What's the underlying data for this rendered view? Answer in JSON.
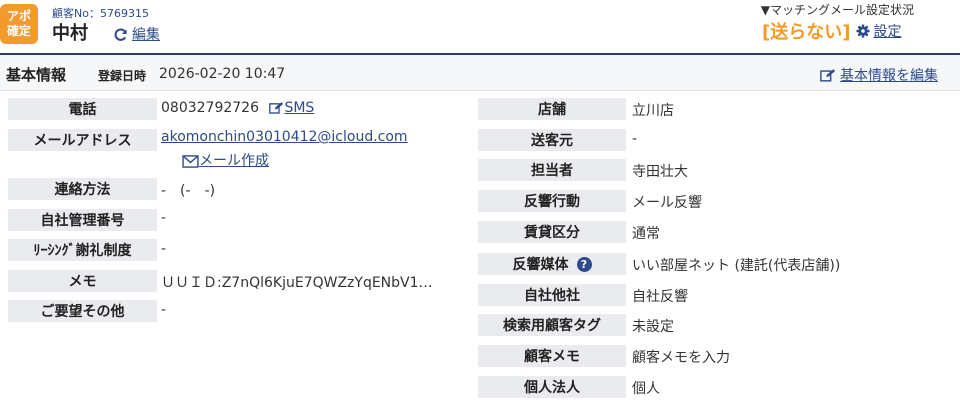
{
  "header": {
    "badge_line1": "アポ",
    "badge_line2": "確定",
    "customer_no": "顧客No：5769315",
    "customer_name": "中村",
    "edit_label": "編集",
    "matching_label": "▼マッチングメール設定状況",
    "no_send_label": "[送らない]",
    "settings_label": "設定",
    "accent_color": "#f39a2c",
    "link_color": "#2c4a8c"
  },
  "section": {
    "title": "基本情報",
    "registered_label": "登録日時",
    "registered_value": "2026-02-20 10:47",
    "edit_basic_label": "基本情報を編集"
  },
  "left_fields": {
    "phone": {
      "label": "電話",
      "value": "08032792726",
      "sms_label": "SMS"
    },
    "email": {
      "label": "メールアドレス",
      "value": "akomonchin03010412@icloud.com",
      "compose_label": "メール作成"
    },
    "contact_method": {
      "label": "連絡方法",
      "value": "-　(-　-)"
    },
    "internal_no": {
      "label": "自社管理番号",
      "value": "-"
    },
    "leasing": {
      "label": "ﾘｰｼﾝｸﾞ謝礼制度",
      "value": "-"
    },
    "memo": {
      "label": "メモ",
      "value": "ＵＵＩＤ:Z7nQl6KjuE7QWZzYqENbV1…"
    },
    "requests": {
      "label": "ご要望その他",
      "value": "-"
    }
  },
  "right_fields": {
    "store": {
      "label": "店舗",
      "value": "立川店"
    },
    "sender": {
      "label": "送客元",
      "value": "-"
    },
    "staff": {
      "label": "担当者",
      "value": "寺田壮大"
    },
    "response_action": {
      "label": "反響行動",
      "value": "メール反響"
    },
    "rent_type": {
      "label": "賃貸区分",
      "value": "通常"
    },
    "response_media": {
      "label": "反響媒体",
      "value": "いい部屋ネット (建託(代表店舗))"
    },
    "own_other": {
      "label": "自社他社",
      "value": "自社反響"
    },
    "search_tag": {
      "label": "検索用顧客タグ",
      "value": "未設定"
    },
    "customer_memo": {
      "label": "顧客メモ",
      "value": "顧客メモを入力"
    },
    "individual_corp": {
      "label": "個人法人",
      "value": "個人"
    }
  },
  "icons": {
    "refresh": "refresh-icon",
    "gear": "gear-icon",
    "edit": "edit-icon",
    "mail": "mail-icon",
    "help": "question-circle-icon"
  }
}
